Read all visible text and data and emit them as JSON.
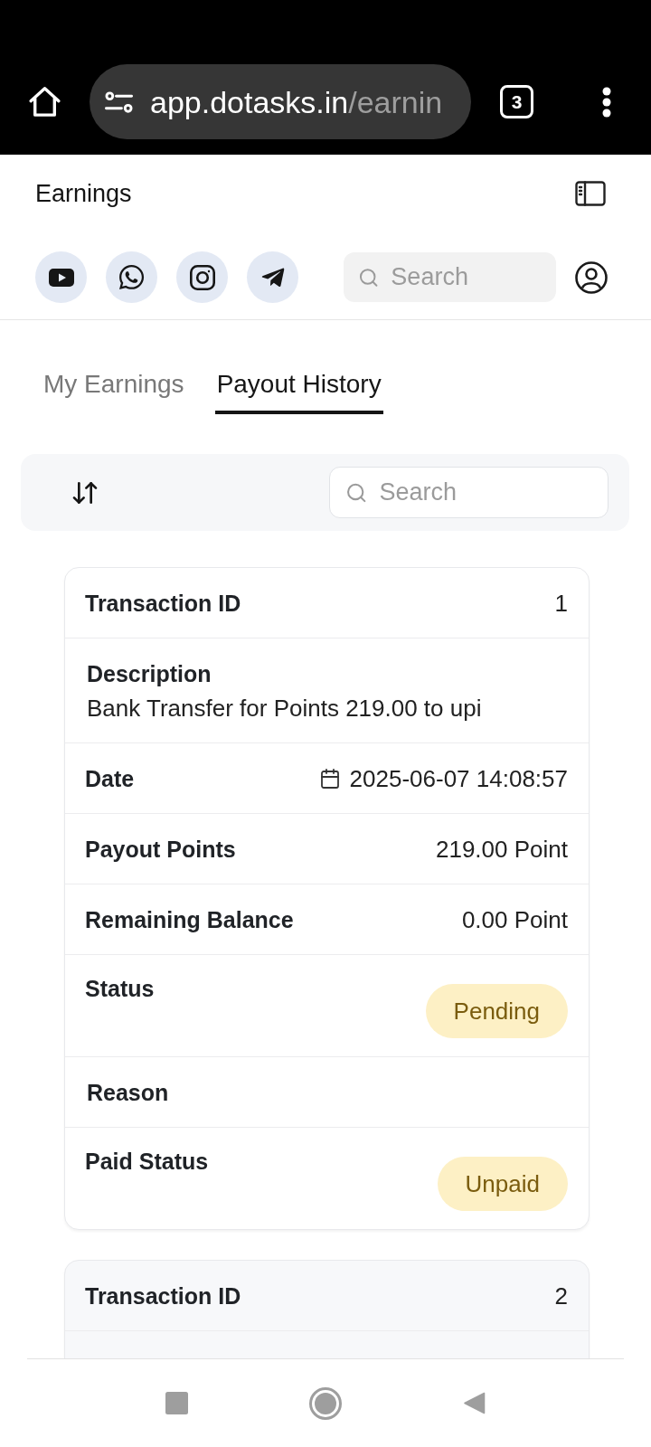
{
  "browser": {
    "url_host": "app.dotasks.in",
    "url_path": "/earnin",
    "tab_count": "3"
  },
  "header": {
    "title": "Earnings",
    "search_placeholder": "Search"
  },
  "tabs": [
    {
      "label": "My Earnings",
      "selected": false
    },
    {
      "label": "Payout History",
      "selected": true
    }
  ],
  "toolbar": {
    "search_placeholder": "Search"
  },
  "transactions": [
    {
      "fields": [
        {
          "kind": "inline",
          "label": "Transaction ID",
          "value": "1"
        },
        {
          "kind": "stacked",
          "label": "Description",
          "value": "Bank Transfer for Points 219.00 to upi"
        },
        {
          "kind": "date",
          "label": "Date",
          "value": "2025-06-07 14:08:57"
        },
        {
          "kind": "inline",
          "label": "Payout Points",
          "value": "219.00 Point"
        },
        {
          "kind": "inline",
          "label": "Remaining Balance",
          "value": "0.00 Point"
        },
        {
          "kind": "badge",
          "label": "Status",
          "value": "Pending"
        },
        {
          "kind": "stacked",
          "label": "Reason"
        },
        {
          "kind": "badge",
          "label": "Paid Status",
          "value": "Unpaid"
        }
      ]
    },
    {
      "fields": [
        {
          "kind": "inline",
          "label": "Transaction ID",
          "value": "2"
        }
      ]
    }
  ]
}
